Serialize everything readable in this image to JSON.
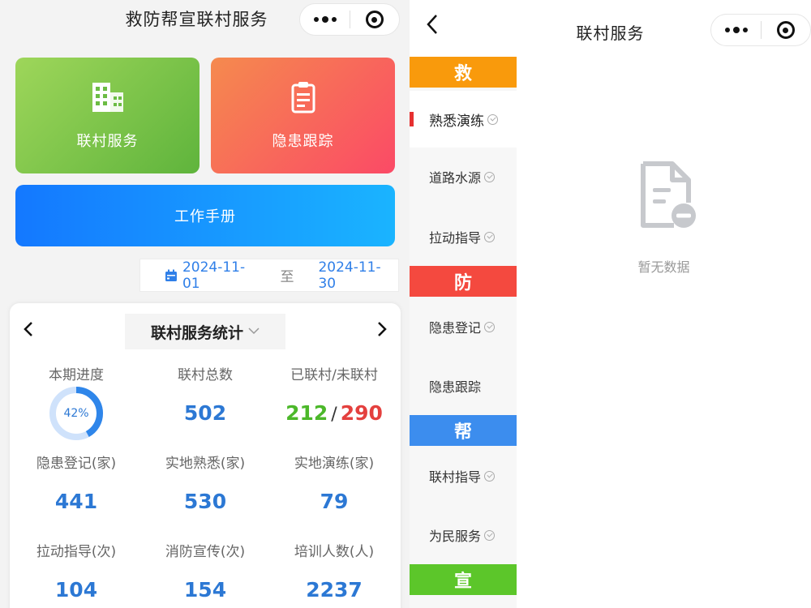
{
  "left": {
    "title": "救防帮宣联村服务",
    "tiles": {
      "village_service": "联村服务",
      "hazard_tracking": "隐患跟踪",
      "work_manual": "工作手册"
    },
    "date_range": {
      "start": "2024-11-01",
      "separator": "至",
      "end": "2024-11-30"
    },
    "stats_card": {
      "selector_label": "联村服务统计",
      "progress": {
        "label": "本期进度",
        "value": "42%",
        "fraction": 0.42
      },
      "total_villages": {
        "label": "联村总数",
        "value": "502"
      },
      "linked_unlinked": {
        "label": "已联村/未联村",
        "linked": "212",
        "separator": "/",
        "unlinked": "290"
      },
      "hazard_register": {
        "label": "隐患登记(家)",
        "value": "441"
      },
      "site_familiarize": {
        "label": "实地熟悉(家)",
        "value": "530"
      },
      "site_drill": {
        "label": "实地演练(家)",
        "value": "79"
      },
      "guidance": {
        "label": "拉动指导(次)",
        "value": "104"
      },
      "fire_publicity": {
        "label": "消防宣传(次)",
        "value": "154"
      },
      "trainees": {
        "label": "培训人数(人)",
        "value": "2237"
      }
    },
    "colors": {
      "green_tile": "#5fb43c",
      "red_tile": "#fb4a66",
      "blue_tile": "#1478ff",
      "accent_blue": "#2c78d4"
    }
  },
  "right": {
    "title": "联村服务",
    "back_icon": "chevron-left-icon",
    "categories": [
      {
        "label": "救",
        "color": "#f99a0c"
      },
      {
        "label": "防",
        "color": "#f4493f"
      },
      {
        "label": "帮",
        "color": "#3c8dee"
      },
      {
        "label": "宣",
        "color": "#5cc62a"
      }
    ],
    "items": [
      {
        "label": "熟悉演练",
        "checked": true,
        "active": true
      },
      {
        "label": "道路水源",
        "checked": true
      },
      {
        "label": "拉动指导",
        "checked": true
      },
      {
        "label": "隐患登记",
        "checked": true
      },
      {
        "label": "隐患跟踪",
        "checked": false
      },
      {
        "label": "联村指导",
        "checked": true
      },
      {
        "label": "为民服务",
        "checked": true
      }
    ],
    "empty_text": "暂无数据",
    "empty_icon": "document-minus-icon"
  }
}
